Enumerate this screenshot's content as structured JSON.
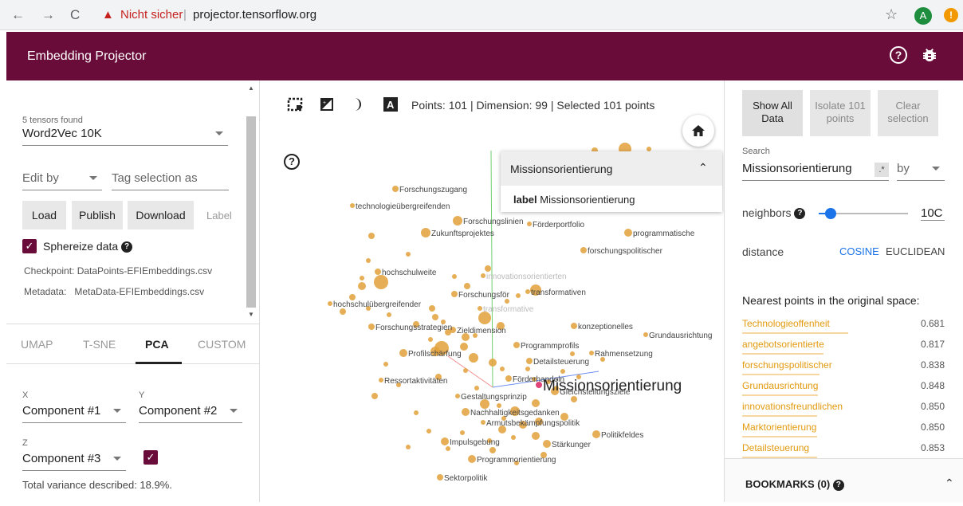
{
  "browser": {
    "back": "←",
    "forward": "→",
    "reload": "C",
    "security_warning": "Nicht sicher",
    "separator": "|",
    "url": "projector.tensorflow.org",
    "avatar": "A"
  },
  "app": {
    "title": "Embedding Projector"
  },
  "left_panel": {
    "tensors_found": "5 tensors found",
    "tensor_selected": "Word2Vec 10K",
    "edit_by": "Edit by",
    "tag_selection_placeholder": "Tag selection as",
    "buttons": {
      "load": "Load",
      "publish": "Publish",
      "download": "Download",
      "label": "Label"
    },
    "sphereize_label": "Sphereize data",
    "checkpoint": "Checkpoint: DataPoints-EFIEmbeddings.csv",
    "metadata": "Metadata:   MetaData-EFIEmbeddings.csv",
    "tabs": [
      "UMAP",
      "T-SNE",
      "PCA",
      "CUSTOM"
    ],
    "active_tab": "PCA",
    "x_label": "X",
    "y_label": "Y",
    "z_label": "Z",
    "x_component": "Component #1",
    "y_component": "Component #2",
    "z_component": "Component #3",
    "variance": "Total variance described: 18.9%."
  },
  "center": {
    "stats": "Points: 101 | Dimension: 99 | Selected 101 points",
    "popup": {
      "title": "Missionsorientierung",
      "label_key": "label",
      "label_value": "Missionsorientierung"
    },
    "selected_point_label": "Missionsorientierung",
    "point_labels": [
      "Forschungszugang",
      "technologieübergreifenden",
      "Forschungslinien",
      "Förderportfolio",
      "programmatische",
      "Zukunftsprojektes",
      "forschungspolitischer",
      "hochschulweite",
      "innovationsorientierten",
      "transformativen",
      "Forschungsför",
      "transformative",
      "hochschulübergreifender",
      "konzeptionelles",
      "Grundausrichtung",
      "Forschungsstrategien",
      "Zieldimension",
      "Programmprofils",
      "Profilschärfung",
      "Rahmensetzung",
      "Detailsteuerung",
      "Förderhandeln",
      "Ressortaktivitäten",
      "Gleichstellungsziele",
      "Gestaltungsprinzip",
      "Nachhaltigkeitsgedanken",
      "Armutsbekämpfungspolitik",
      "Politikfeldes",
      "Impulsgebung",
      "Stärkunger",
      "Programmorientierung",
      "Sektorpolitik"
    ]
  },
  "right_panel": {
    "show_all": "Show All Data",
    "isolate": "Isolate 101 points",
    "clear": "Clear selection",
    "search_label": "Search",
    "search_value": "Missionsorientierung",
    "regex": ".*",
    "by": "by",
    "neighbors_label": "neighbors",
    "neighbors_value": "10C",
    "neighbors_fraction": 0.1,
    "distance_label": "distance",
    "cosine": "COSINE",
    "euclidean": "EUCLIDEAN",
    "nearest_title": "Nearest points in the original space:",
    "nearest": [
      {
        "label": "Technologieoffenheit",
        "value": "0.681"
      },
      {
        "label": "angebotsorientierte",
        "value": "0.817"
      },
      {
        "label": "forschungspolitischer",
        "value": "0.838"
      },
      {
        "label": "Grundausrichtung",
        "value": "0.848"
      },
      {
        "label": "innovationsfreundlichen",
        "value": "0.850"
      },
      {
        "label": "Marktorientierung",
        "value": "0.850"
      },
      {
        "label": "Detailsteuerung",
        "value": "0.853"
      }
    ],
    "bookmarks": "BOOKMARKS (0)"
  },
  "colors": {
    "header": "#6a0c3a",
    "point": "#e2a13a",
    "accent_blue": "#1a73e8",
    "nn_label": "#e29a0e",
    "selected_point": "#e0457a"
  }
}
